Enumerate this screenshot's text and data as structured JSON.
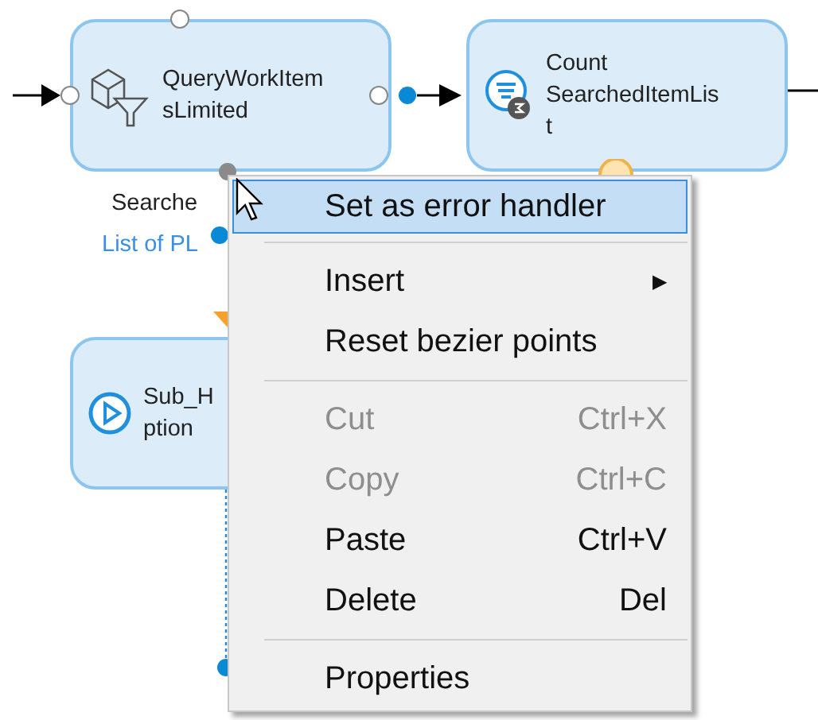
{
  "nodes": [
    {
      "kind": "query",
      "lines": [
        "QueryWorkItem",
        "sLimited"
      ]
    },
    {
      "kind": "count",
      "lines": [
        "Count",
        "SearchedItemLis",
        "t"
      ]
    },
    {
      "kind": "subflow",
      "lines": [
        "Sub_H",
        "ption"
      ]
    }
  ],
  "edge_labels": [
    {
      "kind": "name",
      "text": "Searche"
    },
    {
      "kind": "type",
      "text": "List of PL"
    }
  ],
  "context_menu": {
    "items": [
      {
        "kind": "item",
        "label": "Set as error handler",
        "selected": true,
        "disabled": false
      },
      {
        "kind": "separator"
      },
      {
        "kind": "item",
        "label": "Insert",
        "selected": false,
        "disabled": false,
        "submenu": "▶"
      },
      {
        "kind": "item",
        "label": "Reset bezier points",
        "selected": false,
        "disabled": false
      },
      {
        "kind": "separator"
      },
      {
        "kind": "item",
        "label": "Cut",
        "shortcut": "Ctrl+X",
        "selected": false,
        "disabled": true
      },
      {
        "kind": "item",
        "label": "Copy",
        "shortcut": "Ctrl+C",
        "selected": false,
        "disabled": true
      },
      {
        "kind": "item",
        "label": "Paste",
        "shortcut": "Ctrl+V",
        "selected": false,
        "disabled": false
      },
      {
        "kind": "item",
        "label": "Delete",
        "shortcut": "Del",
        "selected": false,
        "disabled": false
      },
      {
        "kind": "separator"
      },
      {
        "kind": "item",
        "label": "Properties",
        "selected": false,
        "disabled": false
      }
    ]
  }
}
